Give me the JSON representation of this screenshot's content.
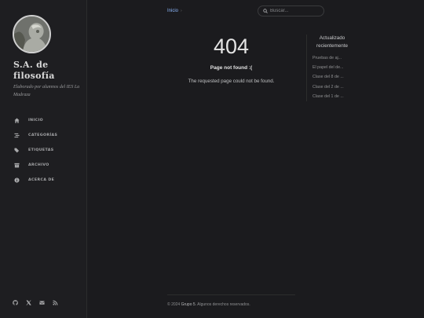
{
  "sidebar": {
    "title": "S.A. de filosofía",
    "subtitle": "Elaborado por alumnos del IES La Madraza",
    "nav": [
      {
        "label": "INICIO",
        "icon": "home-icon"
      },
      {
        "label": "CATEGORÍAS",
        "icon": "stream-icon"
      },
      {
        "label": "ETIQUETAS",
        "icon": "tags-icon"
      },
      {
        "label": "ARCHIVO",
        "icon": "archive-icon"
      },
      {
        "label": "ACERCA DE",
        "icon": "info-icon"
      }
    ],
    "social": [
      "github-icon",
      "x-twitter-icon",
      "email-icon",
      "rss-icon"
    ]
  },
  "topbar": {
    "breadcrumb": "Inicio",
    "breadcrumb_sep": "›",
    "search_placeholder": "Buscar..."
  },
  "main": {
    "code": "404",
    "title": "Page not found :(",
    "message": "The requested page could not be found."
  },
  "panel": {
    "heading": "Actualizado recientemente",
    "items": [
      "Pruebas de aj...",
      "El papel del de...",
      "Clase del 8 de ...",
      "Clase del 2 de ...",
      "Clase del 1 de ..."
    ]
  },
  "footer": {
    "year": "© 2024",
    "owner": "Grupo 5",
    "rights": ". Algunos derechos reservados."
  },
  "colors": {
    "background": "#1b1b1e",
    "sidebar": "#1e1e21",
    "link": "#8ab4f8"
  }
}
